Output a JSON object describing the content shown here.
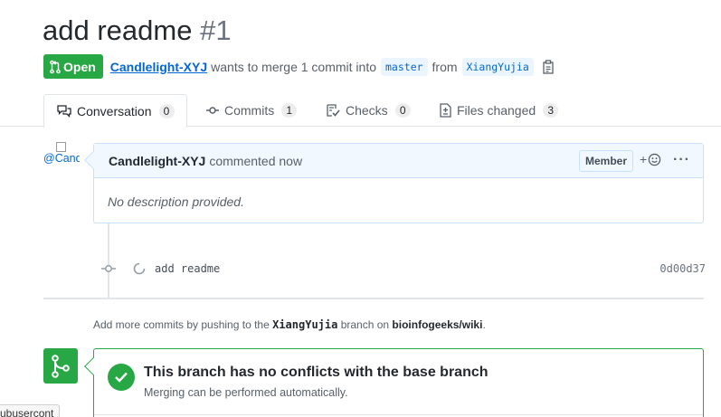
{
  "pr": {
    "title": "add readme",
    "number": "#1",
    "state_label": "Open",
    "author": "Candlelight-XYJ",
    "merge_text": "wants to merge 1 commit into",
    "base_branch": "master",
    "from_text": "from",
    "head_branch": "XiangYujia"
  },
  "tabs": [
    {
      "label": "Conversation",
      "count": "0",
      "icon": "comment-discussion-icon"
    },
    {
      "label": "Commits",
      "count": "1",
      "icon": "git-commit-icon"
    },
    {
      "label": "Checks",
      "count": "0",
      "icon": "checklist-icon"
    },
    {
      "label": "Files changed",
      "count": "3",
      "icon": "file-diff-icon"
    }
  ],
  "comment": {
    "avatar_alt": "@Candlelight",
    "author": "Candlelight-XYJ",
    "action": "commented now",
    "role_badge": "Member",
    "body": "No description provided."
  },
  "commit": {
    "message": "add readme",
    "sha": "0d00d37"
  },
  "hint": {
    "prefix": "Add more commits by pushing to the",
    "branch": "XiangYujia",
    "middle": "branch on",
    "repo": "bioinfogeeks/wiki",
    "suffix": "."
  },
  "merge": {
    "title": "This branch has no conflicts with the base branch",
    "subtitle": "Merging can be performed automatically."
  },
  "status_bar": {
    "url": "ubusercont"
  },
  "colors": {
    "green": "#28a745",
    "link": "#0366d6",
    "comment_header_bg": "#f1f8ff",
    "comment_border": "#c8e1ff"
  }
}
